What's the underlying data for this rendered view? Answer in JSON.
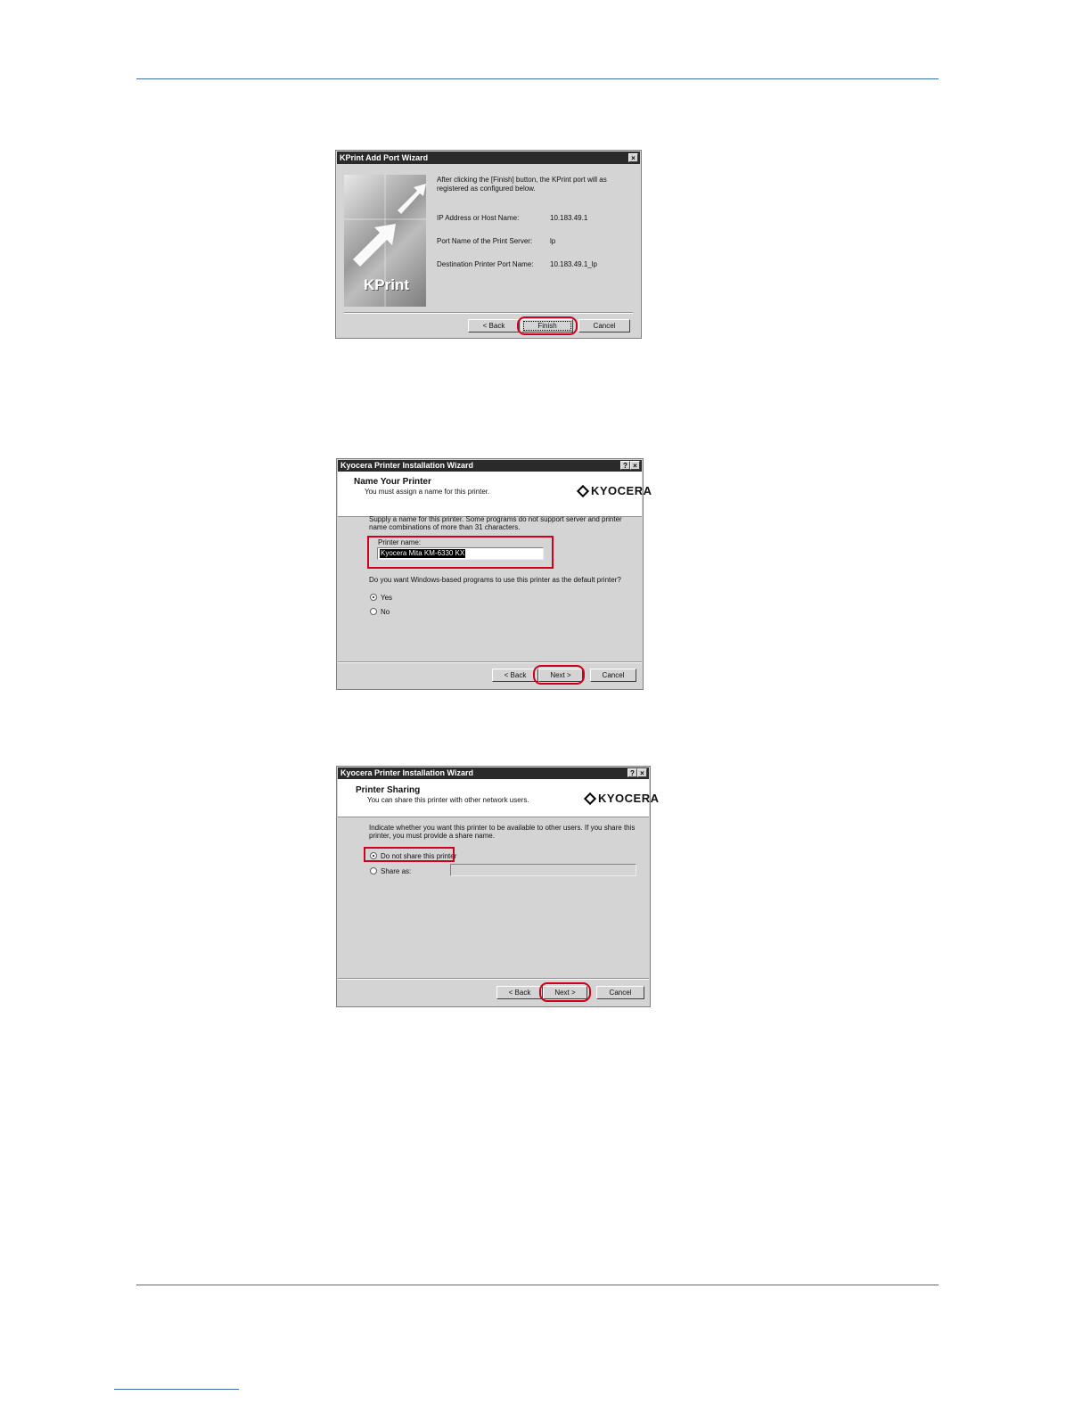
{
  "dialogs": {
    "kprint": {
      "title": "KPrint Add Port Wizard",
      "close": "×",
      "intro": "After clicking the [Finish] button, the KPrint port will as registered as configured below.",
      "rows": [
        {
          "label": "IP Address or Host Name:",
          "value": "10.183.49.1"
        },
        {
          "label": "Port Name of the Print Server:",
          "value": "lp"
        },
        {
          "label": "Destination Printer Port Name:",
          "value": "10.183.49.1_lp"
        }
      ],
      "logo_text": "KPrint",
      "buttons": {
        "back": "< Back",
        "finish": "Finish",
        "cancel": "Cancel"
      }
    },
    "name_printer": {
      "title": "Kyocera Printer Installation Wizard",
      "help": "?",
      "close": "×",
      "heading": "Name Your Printer",
      "subheading": "You must assign a name for this printer.",
      "brand": "KYOCERA",
      "instructions": "Supply a name for this printer. Some programs do not support server and printer name combinations of more than 31 characters.",
      "printer_name_label": "Printer name:",
      "printer_name_value": "Kyocera Mita KM-6330 KX",
      "default_question": "Do you want Windows-based programs to use this printer as the default printer?",
      "options": [
        "Yes",
        "No"
      ],
      "buttons": {
        "back": "< Back",
        "next": "Next >",
        "cancel": "Cancel"
      }
    },
    "sharing": {
      "title": "Kyocera Printer Installation Wizard",
      "help": "?",
      "close": "×",
      "heading": "Printer Sharing",
      "subheading": "You can share this printer with other network users.",
      "brand": "KYOCERA",
      "instructions": "Indicate whether you want this printer to be available to other users. If you share this printer, you must provide a share name.",
      "options": [
        "Do not share this printer",
        "Share as:"
      ],
      "buttons": {
        "back": "< Back",
        "next": "Next >",
        "cancel": "Cancel"
      }
    }
  }
}
